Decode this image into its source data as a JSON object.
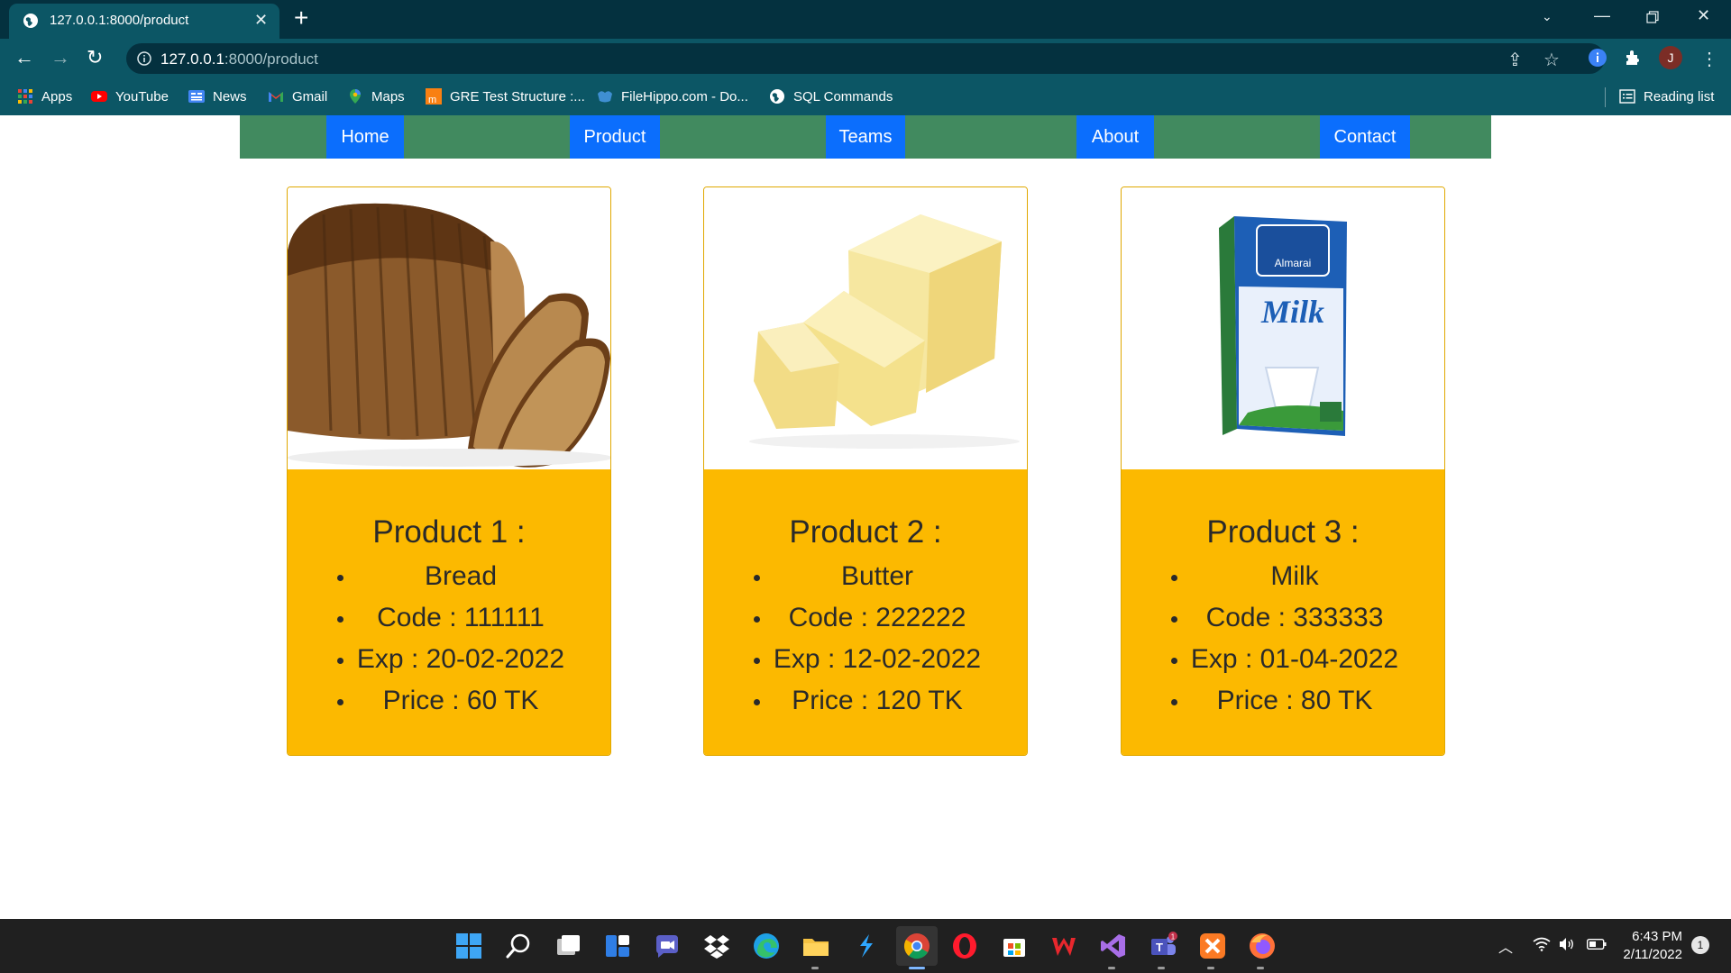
{
  "browser": {
    "tab_title": "127.0.0.1:8000/product",
    "url_host": "127.0.0.1",
    "url_path": ":8000/product",
    "bookmarks": [
      {
        "label": "Apps",
        "icon": "apps-grid-icon"
      },
      {
        "label": "YouTube",
        "icon": "youtube-icon"
      },
      {
        "label": "News",
        "icon": "google-news-icon"
      },
      {
        "label": "Gmail",
        "icon": "gmail-icon"
      },
      {
        "label": "Maps",
        "icon": "google-maps-icon"
      },
      {
        "label": "GRE Test Structure :...",
        "icon": "moodle-icon"
      },
      {
        "label": "FileHippo.com - Do...",
        "icon": "filehippo-icon"
      },
      {
        "label": "SQL Commands",
        "icon": "globe-icon"
      }
    ],
    "reading_list": "Reading list",
    "profile_initial": "J"
  },
  "site": {
    "nav": [
      "Home",
      "Product",
      "Teams",
      "About",
      "Contact"
    ],
    "nav_color": "#418a5f",
    "button_color": "#0b6efd",
    "card_color": "#fcb900"
  },
  "products": [
    {
      "title": "Product 1 :",
      "name": "Bread",
      "code": "Code : 111111",
      "exp": "Exp : 20-02-2022",
      "price": "Price : 60 TK",
      "image": "bread-image"
    },
    {
      "title": "Product 2 :",
      "name": "Butter",
      "code": "Code : 222222",
      "exp": "Exp : 12-02-2022",
      "price": "Price : 120 TK",
      "image": "butter-image"
    },
    {
      "title": "Product 3 :",
      "name": "Milk",
      "code": "Code : 333333",
      "exp": "Exp : 01-04-2022",
      "price": "Price : 80 TK",
      "image": "milk-carton-image"
    }
  ],
  "milk_brand": "Almarai",
  "milk_label": "Milk",
  "taskbar": {
    "apps": [
      "windows-start-icon",
      "search-icon",
      "task-view-icon",
      "widgets-icon",
      "teams-chat-icon",
      "dropbox-icon",
      "edge-icon",
      "file-explorer-icon",
      "vscode-blue-icon",
      "chrome-icon",
      "opera-icon",
      "microsoft-store-icon",
      "wps-office-icon",
      "visual-studio-icon",
      "teams-icon",
      "xampp-icon",
      "firefox-icon"
    ],
    "time": "6:43 PM",
    "date": "2/11/2022",
    "teams_badge": "1",
    "notification_count": "1"
  }
}
